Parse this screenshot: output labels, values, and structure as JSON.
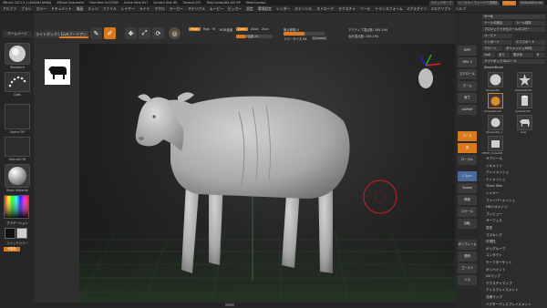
{
  "titlebar": {
    "app": "ZBrush 2021.5.1 [KASAKI AHBA]",
    "document": "ZBrush Document",
    "stats": [
      "Free Mem 6.075GB",
      "Active Mem 617",
      "Scratch Disk 89",
      "Timer▸0.051",
      "PolyCount▸264.455 KP",
      "MeshCount▸1"
    ],
    "quicksave": "クイックセーブ",
    "transparency": "シースルー ウィンドウ透明化",
    "menus_btn": "Menus",
    "script": "DefaultZScript"
  },
  "menubar": [
    "アルファ",
    "ブラシ",
    "カラー",
    "ドキュメント",
    "描画",
    "エッジ",
    "ファイル",
    "レイヤー",
    "ライト",
    "マクロ",
    "マーカー",
    "マテリアル",
    "ムービー",
    "ピッカー",
    "設定",
    "環境設定",
    "レンダー",
    "ステンシル",
    "ストローク",
    "テクスチャ",
    "ツール",
    "トランスフォーム",
    "Zプラグイン",
    "Zスクリプト",
    "ヘルプ"
  ],
  "left_tray": {
    "homepage": "ホームページ",
    "brush": "Standard",
    "stroke": "Dots",
    "alpha": "Alpha Off",
    "texture": "Texture Off",
    "material": "Basic Material",
    "gradient": "グラデーション",
    "switch_color": "スイッチカラー",
    "alternate": "代替色"
  },
  "shelf": {
    "tabs": [
      "ライトボックス",
      "Liveブーリアン"
    ],
    "buttons": [
      "edit",
      "draw",
      "move",
      "scale",
      "rotate"
    ],
    "mrgb": "Mrgb",
    "rgb": "Rgb",
    "m": "M",
    "zadd": "Zadd",
    "zsub": "Zsub",
    "zcut": "Zcut",
    "rgb_intensity": "RGB強度",
    "z_intensity": "Z強度 25",
    "focal_shift": "焦点移動 0",
    "draw_size": "ドローサイズ 64",
    "dynamic": "Dynamic",
    "active_points": "アクティブ頂点数: 265,194",
    "total_points": "合計頂点数: 265,194"
  },
  "viewport_toolbar": [
    "BPR",
    "SPix 3",
    "スクロール",
    "ズーム",
    "実寸",
    "AAHalf",
    "パース",
    "床",
    "ローカル",
    "L.Sym",
    "Xpose",
    "移動",
    "スケール",
    "回転",
    "ポリフレーム",
    "透明",
    "ゴースト",
    "ソロ"
  ],
  "right_panel": {
    "header": [
      "ツール",
      "ロード",
      "ツールの読込",
      "ツール保存",
      "プロジェクトからツールのコピー",
      "ペースト",
      "インポート",
      "エクスポート",
      "クローン",
      "ポリメッシュ3D化",
      "GoZ",
      "全て",
      "表示中",
      "R"
    ],
    "lightbox_tools": "ライトボックス▸ツール",
    "current_tool": "SimpleBrush",
    "tools": [
      "Sphere3D",
      "PolyMesh3D",
      "SimpleBrush",
      "Cylinder3D",
      "Sphere3D_1",
      "Cow",
      "PM3D_Cube3D"
    ],
    "list": [
      "サブツール",
      "ジオメトリ",
      "アレイメッシュ",
      "ナノメッシュ",
      "Thick Skin",
      "レイヤー",
      "ファイバーメッシュ",
      "HDジオメトリ",
      "プレビュー",
      "サーフェス",
      "変形",
      "マスキング",
      "可視性",
      "ポリグループ",
      "コンタクト",
      "モーフターゲット",
      "ポリペイント",
      "UVマップ",
      "テクスチャマップ",
      "ディスプレイスメント",
      "法線マップ",
      "ベクターディスプレイスメント"
    ]
  },
  "colors": {
    "accent": "#e07a22",
    "bg": "#2a2a2a",
    "model": "#b8b8b8"
  }
}
